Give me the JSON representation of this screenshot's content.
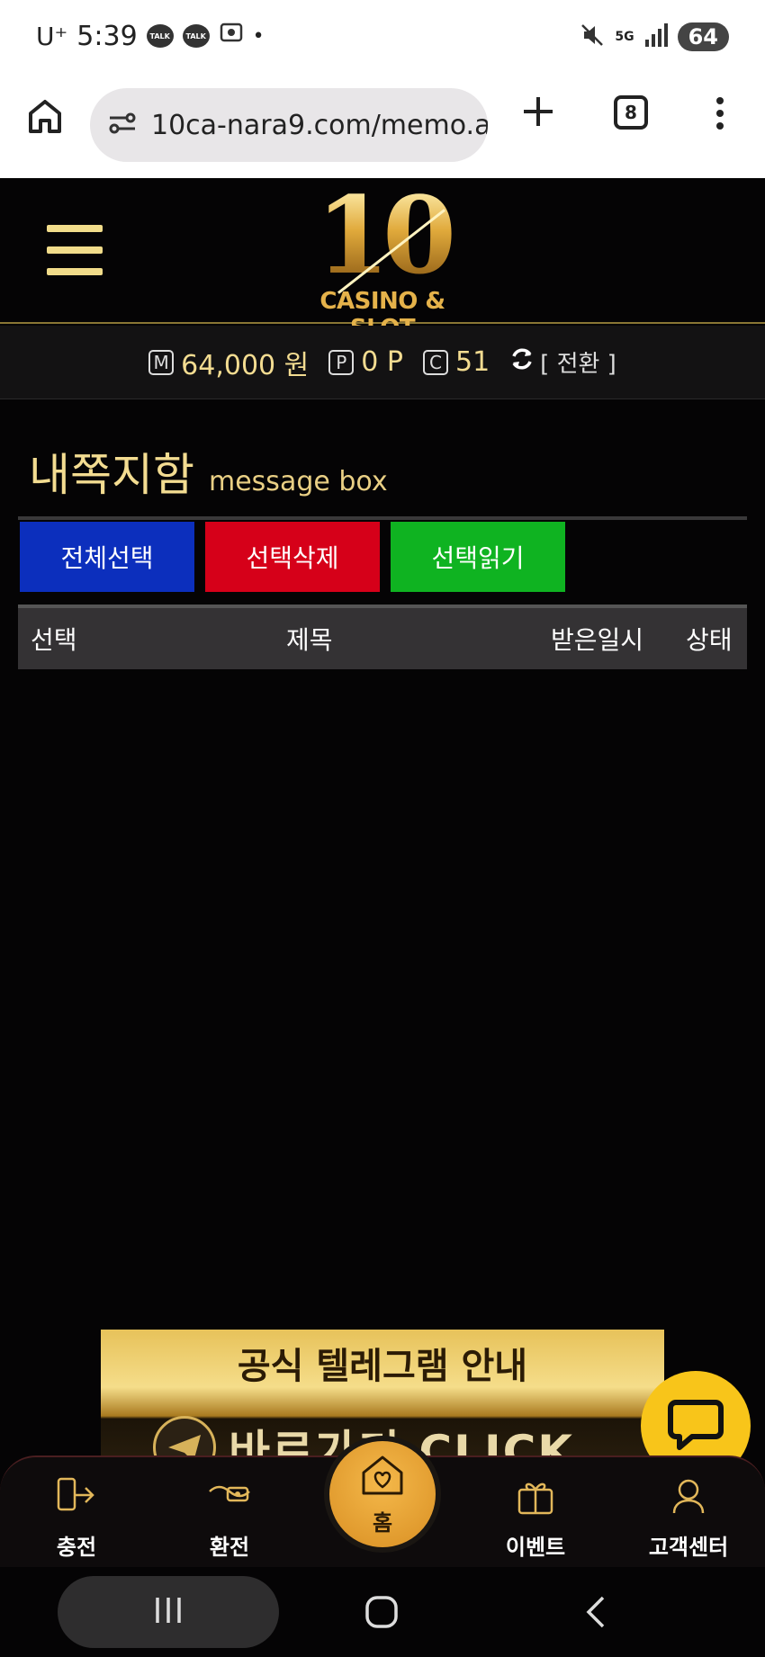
{
  "status_bar": {
    "carrier": "U⁺",
    "time": "5:39",
    "notif_1": "TALK",
    "notif_2": "TALK",
    "dot": "•",
    "network": "5G",
    "battery": "64"
  },
  "browser": {
    "url": "10ca-nara9.com/memo.a",
    "tab_count": "8"
  },
  "site": {
    "logo_number": "10",
    "logo_text": "CASINO & SLOT"
  },
  "balance": {
    "money_badge": "M",
    "money": "64,000 원",
    "point_badge": "P",
    "points": "0 P",
    "coin_badge": "C",
    "coins": "51",
    "switch_label": "[ 전환 ]"
  },
  "page": {
    "title": "내쪽지함",
    "subtitle": "message box"
  },
  "actions": {
    "select_all": "전체선택",
    "delete_selected": "선택삭제",
    "read_selected": "선택읽기"
  },
  "table": {
    "col_select": "선택",
    "col_title": "제목",
    "col_received": "받은일시",
    "col_status": "상태"
  },
  "banner": {
    "title": "공식 텔레그램 안내",
    "cta": "바로가기 CLICK"
  },
  "bottom_nav": {
    "deposit": "충전",
    "withdraw": "환전",
    "home": "홈",
    "event": "이벤트",
    "support": "고객센터"
  },
  "colors": {
    "gold": "#f3dc91",
    "blue": "#0c2fbd",
    "red": "#d60019",
    "green": "#0fb321",
    "fab": "#f8c51a"
  }
}
